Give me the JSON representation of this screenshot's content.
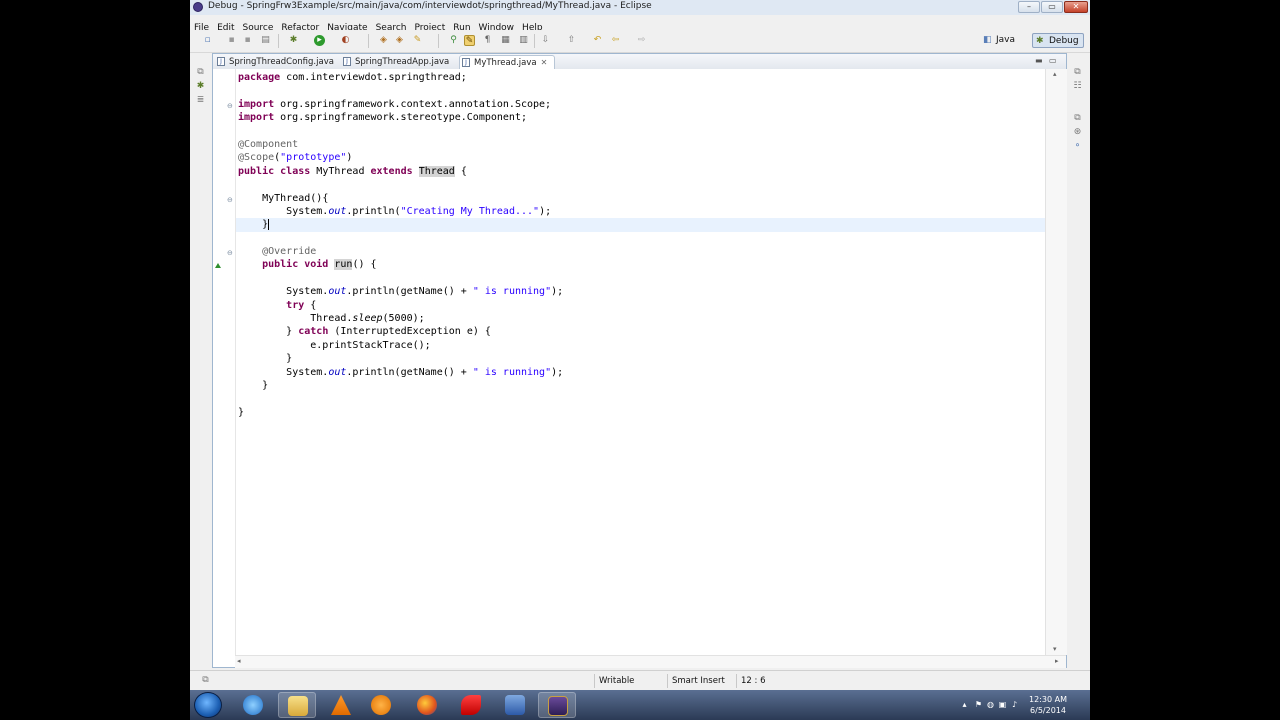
{
  "window": {
    "title": "Debug - SpringFrw3Example/src/main/java/com/interviewdot/springthread/MyThread.java - Eclipse",
    "controls": [
      "–",
      "▭",
      "✕"
    ]
  },
  "menu": [
    "File",
    "Edit",
    "Source",
    "Refactor",
    "Navigate",
    "Search",
    "Project",
    "Run",
    "Window",
    "Help"
  ],
  "perspectives": [
    {
      "label": "Java",
      "active": false
    },
    {
      "label": "Debug",
      "active": true
    }
  ],
  "tabs": [
    {
      "label": "SpringThreadConfig.java",
      "active": false
    },
    {
      "label": "SpringThreadApp.java",
      "active": false
    },
    {
      "label": "MyThread.java",
      "active": true,
      "close": "✕"
    }
  ],
  "code": {
    "package_kw": "package",
    "package_name": " com.interviewdot.springthread;",
    "import_kw": "import",
    "import1": " org.springframework.context.annotation.Scope;",
    "import2": " org.springframework.stereotype.Component;",
    "ann_component": "@Component",
    "ann_scope": "@Scope",
    "scope_open": "(",
    "scope_value": "\"prototype\"",
    "scope_close": ")",
    "public_kw": "public",
    "class_kw": "class",
    "class_name": "MyThread",
    "extends_kw": "extends",
    "super_class": "Thread",
    "brace_open": "{",
    "brace_close": "}",
    "ctor_name": "MyThread()",
    "system": "System.",
    "out": "out",
    "println": ".println(",
    "creating_str": "\"Creating My Thread...\"",
    "println_end": ");",
    "ann_override": "@Override",
    "void_kw": "void",
    "run_name": "run",
    "run_parens": "() {",
    "getname_concat": "getName() + ",
    "running_str": "\" is running\"",
    "try_kw": "try",
    "thread_prefix": "Thread.",
    "sleep": "sleep",
    "sleep_args": "(5000);",
    "catch_kw": "catch",
    "catch_args": " (InterruptedException e) {",
    "print_stack": "e.printStackTrace();"
  },
  "status": {
    "writable": "Writable",
    "insert_mode": "Smart Insert",
    "position": "12 : 6"
  },
  "clock": {
    "time": "12:30 AM",
    "date": "6/5/2014"
  },
  "colors": {
    "keyword": "#7f0055",
    "string": "#2a00ff",
    "annotation": "#646464",
    "field": "#0000c0",
    "current_line": "#e8f2fe"
  }
}
